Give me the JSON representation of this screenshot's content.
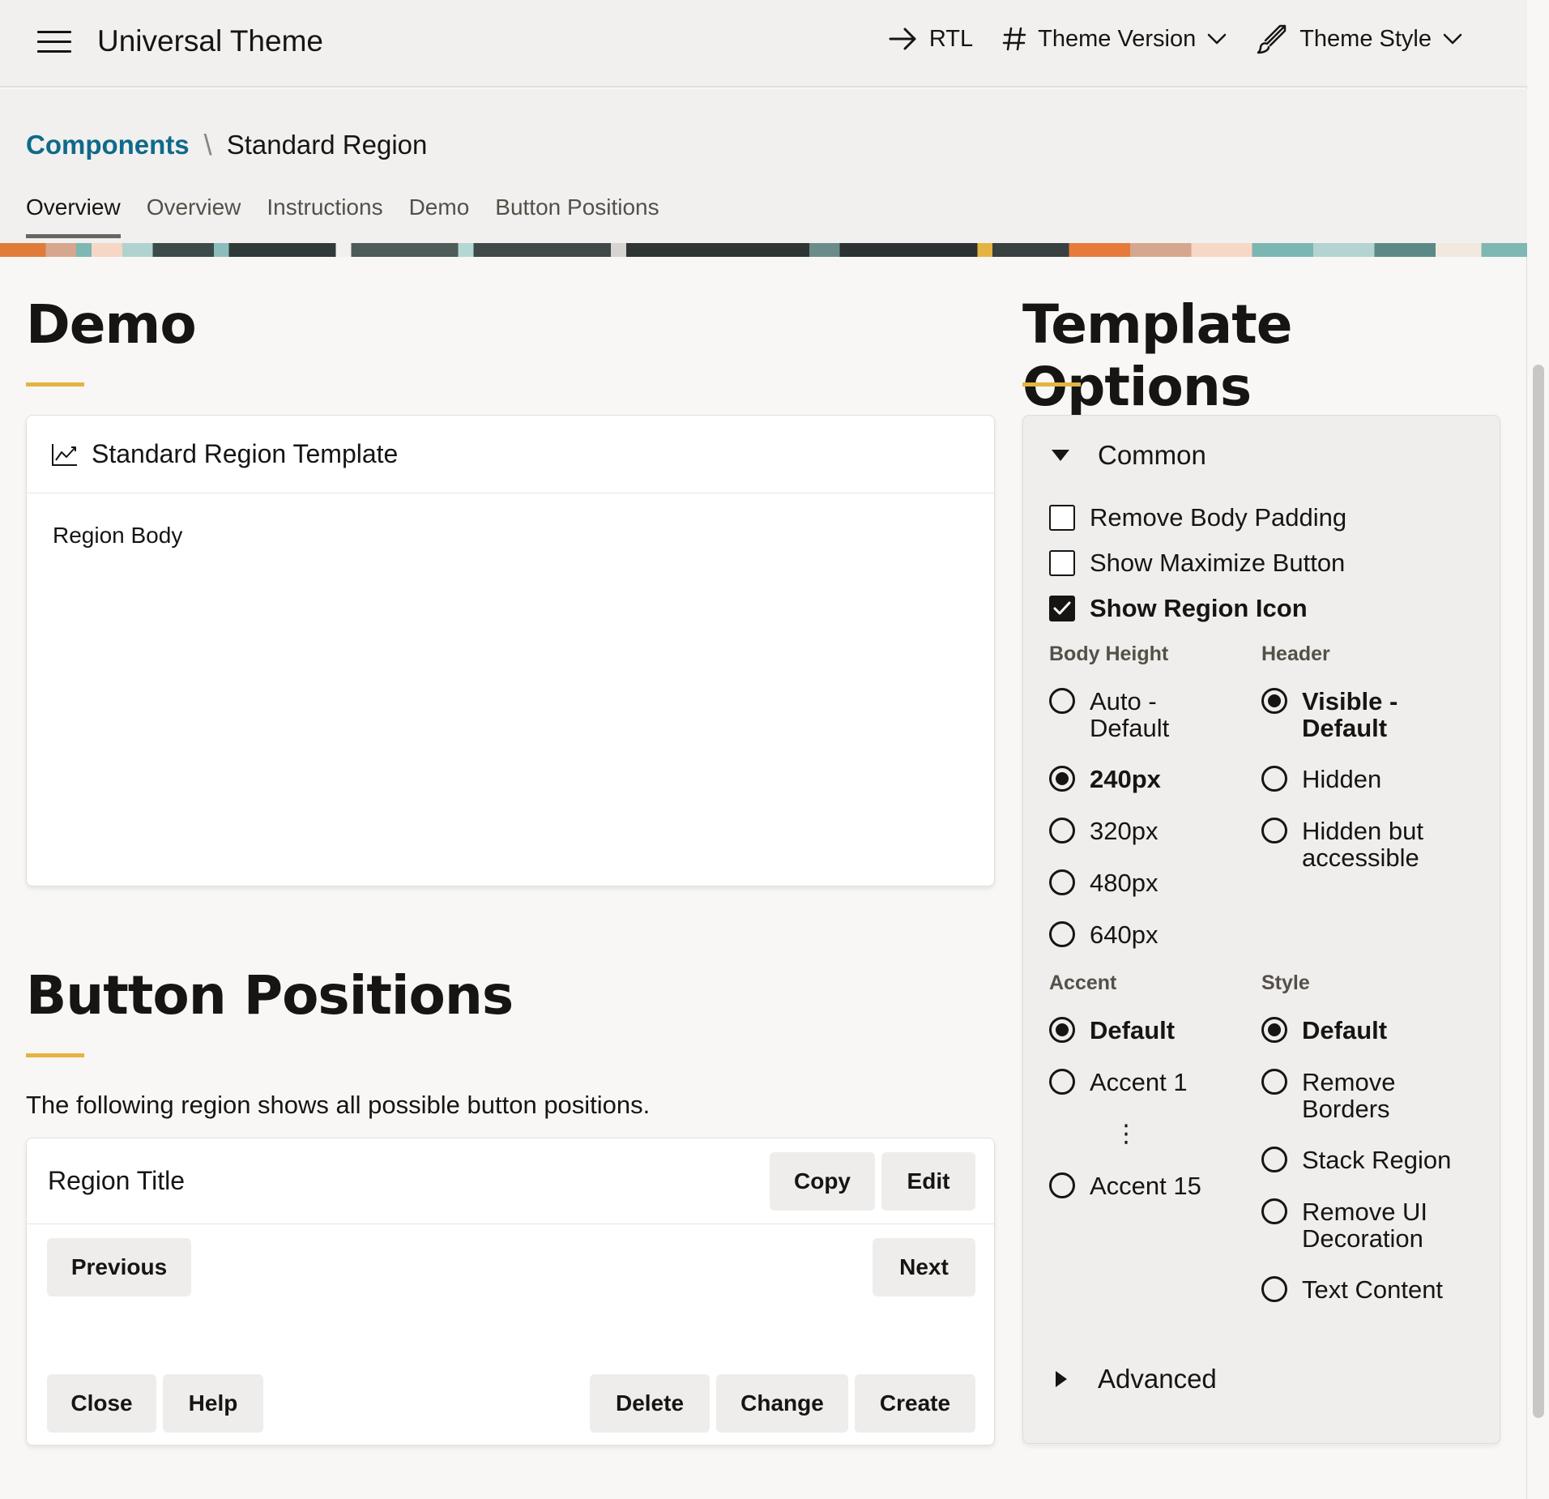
{
  "topbar": {
    "title": "Universal Theme",
    "rtl_label": "RTL",
    "version_label": "Theme Version",
    "style_label": "Theme Style"
  },
  "breadcrumb": {
    "parent": "Components",
    "separator": "\\",
    "current": "Standard Region"
  },
  "tabs": [
    "Overview",
    "Overview",
    "Instructions",
    "Demo",
    "Button Positions"
  ],
  "demo": {
    "title": "Demo",
    "card_title": "Standard Region Template",
    "card_body": "Region Body"
  },
  "button_positions": {
    "title": "Button Positions",
    "description": "The following region shows all possible button positions.",
    "region_title": "Region Title",
    "buttons": {
      "copy": "Copy",
      "edit": "Edit",
      "previous": "Previous",
      "next": "Next",
      "close": "Close",
      "help": "Help",
      "delete": "Delete",
      "change": "Change",
      "create": "Create"
    }
  },
  "template_options": {
    "title": "Template Options",
    "common_label": "Common",
    "advanced_label": "Advanced",
    "checkboxes": [
      {
        "label": "Remove Body Padding",
        "checked": false
      },
      {
        "label": "Show Maximize Button",
        "checked": false
      },
      {
        "label": "Show Region Icon",
        "checked": true
      }
    ],
    "body_height": {
      "label": "Body Height",
      "options": [
        "Auto - Default",
        "240px",
        "320px",
        "480px",
        "640px"
      ],
      "selected": "240px"
    },
    "header": {
      "label": "Header",
      "options": [
        "Visible - Default",
        "Hidden",
        "Hidden but accessible"
      ],
      "selected": "Visible - Default"
    },
    "accent": {
      "label": "Accent",
      "options": [
        "Default",
        "Accent 1",
        "Accent 15"
      ],
      "ellipsis": "⋮",
      "selected": "Default"
    },
    "style": {
      "label": "Style",
      "options": [
        "Default",
        "Remove Borders",
        "Stack Region",
        "Remove UI Decoration",
        "Text Content"
      ],
      "selected": "Default"
    }
  },
  "icons": [
    "menu-icon",
    "arrow-right-icon",
    "hash-icon",
    "chevron-down-icon",
    "brush-icon",
    "line-chart-icon",
    "caret-down-icon",
    "caret-right-icon",
    "checkmark-icon"
  ]
}
